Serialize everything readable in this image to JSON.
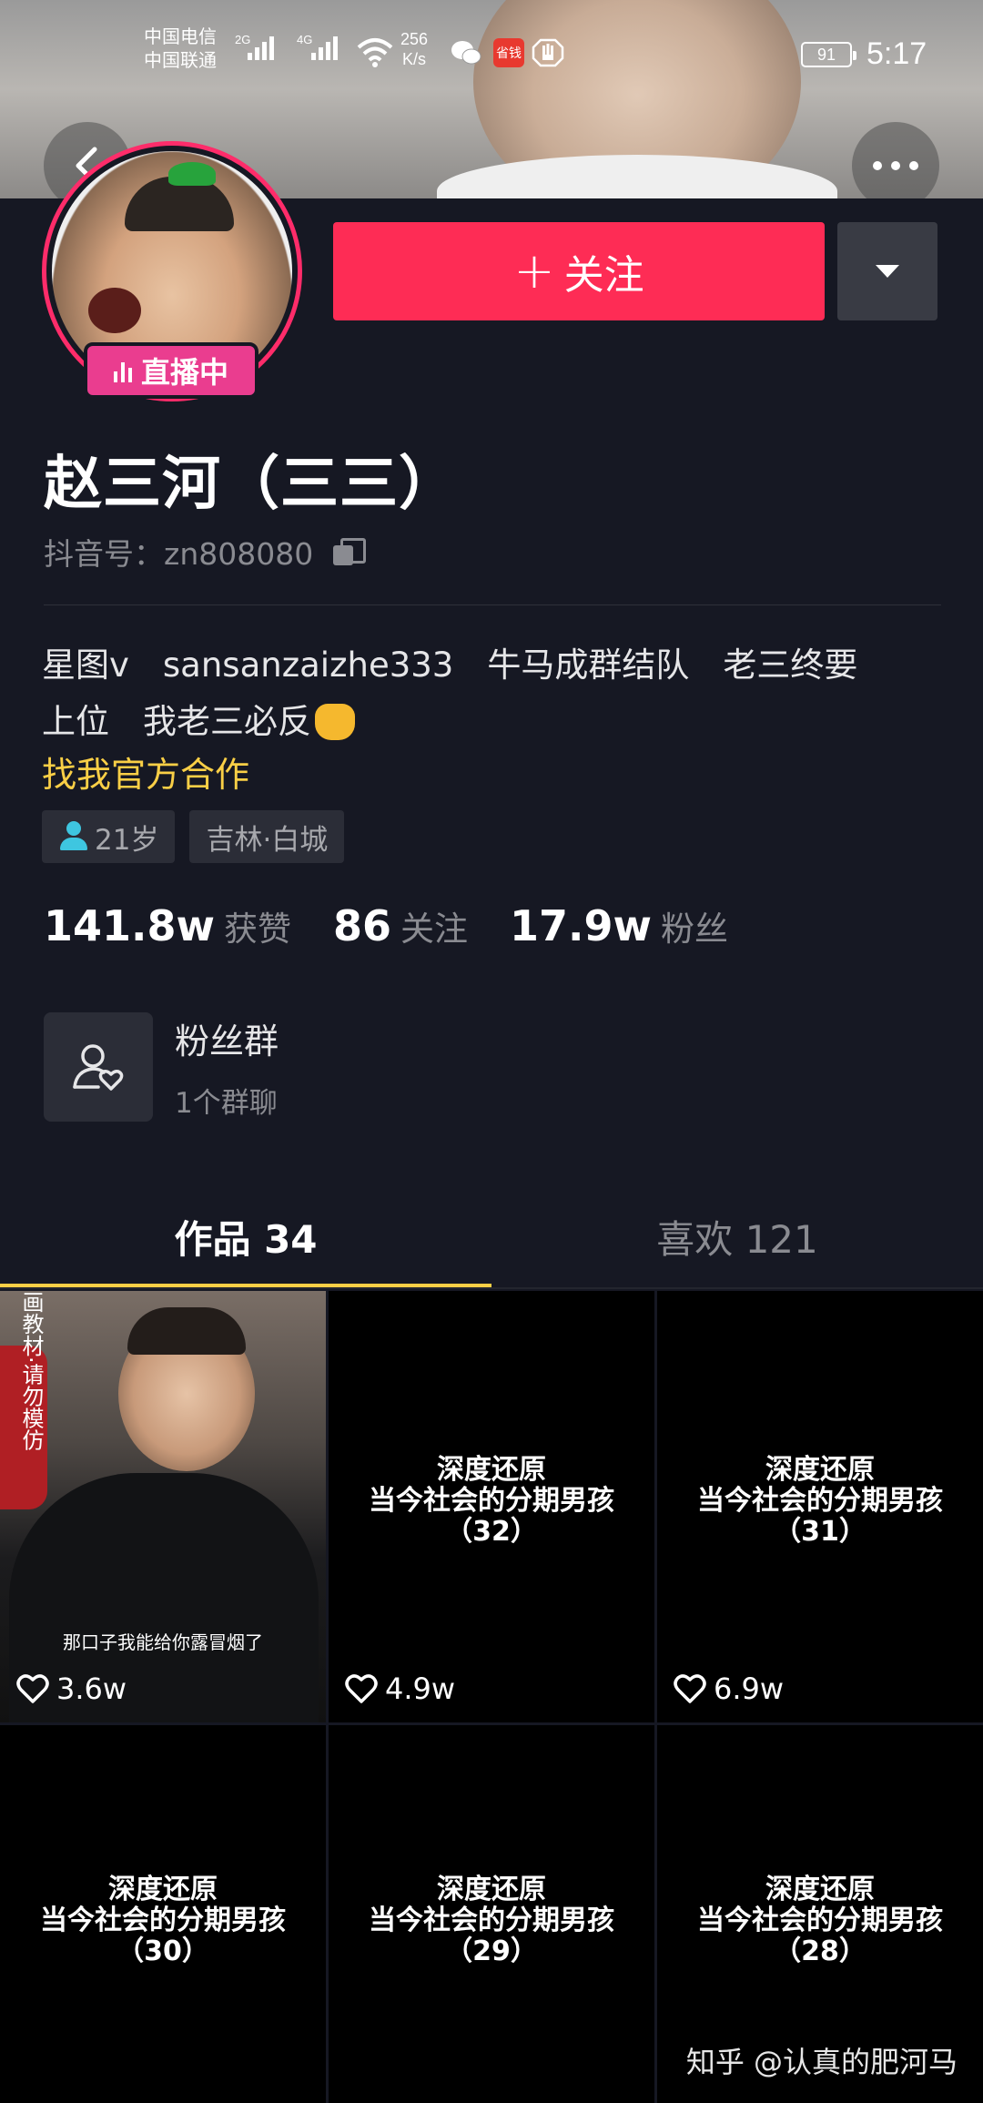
{
  "status_bar": {
    "carrier1": "中国电信",
    "carrier2": "中国联通",
    "net1": "2G",
    "net2": "4G",
    "speed_value": "256",
    "speed_unit": "K/s",
    "app_badge": "省钱",
    "battery": "91",
    "time": "5:17"
  },
  "profile": {
    "live_label": "直播中",
    "follow_label": "关注",
    "nickname": "赵三河（三三）",
    "douyin_id": "抖音号：zn808080",
    "bio_line1": "星图v　sansanzaizhe333　牛马成群结队　老三终要",
    "bio_line2": "上位　我老三必反",
    "cooperate": "找我官方合作",
    "age_tag": "21岁",
    "location_tag": "吉林·白城",
    "stats": {
      "likes_num": "141.8w",
      "likes_label": "获赞",
      "following_num": "86",
      "following_label": "关注",
      "fans_num": "17.9w",
      "fans_label": "粉丝"
    },
    "fan_group_title": "粉丝群",
    "fan_group_sub": "1个群聊"
  },
  "tabs": {
    "works": "作品 34",
    "likes": "喜欢 121"
  },
  "videos": [
    {
      "caption": "",
      "likes": "3.6w",
      "side_text": "画教材·请勿模仿",
      "subtitle": "那口子我能给你露冒烟了"
    },
    {
      "caption": "深度还原\n当今社会的分期男孩\n（32）",
      "likes": "4.9w"
    },
    {
      "caption": "深度还原\n当今社会的分期男孩\n（31）",
      "likes": "6.9w"
    },
    {
      "caption": "深度还原\n当今社会的分期男孩\n（30）",
      "likes": ""
    },
    {
      "caption": "深度还原\n当今社会的分期男孩\n（29）",
      "likes": ""
    },
    {
      "caption": "深度还原\n当今社会的分期男孩\n（28）",
      "likes": ""
    }
  ],
  "watermark": "知乎 @认真的肥河马",
  "colors": {
    "background": "#161823",
    "follow": "#fe2c55",
    "live_ring": "#fe2c6a",
    "accent_yellow": "#facf46"
  }
}
